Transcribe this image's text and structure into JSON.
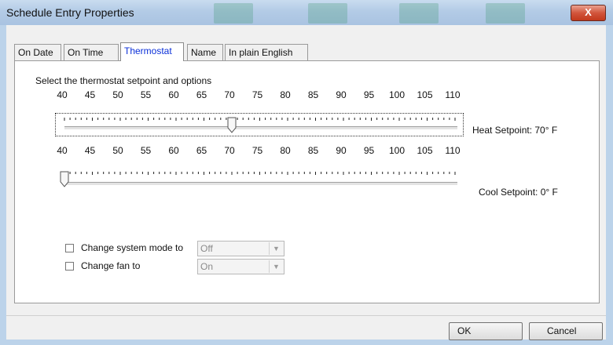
{
  "window": {
    "title": "Schedule Entry Properties",
    "close_glyph": "X"
  },
  "tabs": [
    {
      "label": "On Date"
    },
    {
      "label": "On Time"
    },
    {
      "label": "Thermostat",
      "active": true
    },
    {
      "label": "Name"
    },
    {
      "label": "In plain English"
    }
  ],
  "thermostat": {
    "instruction": "Select the thermostat setpoint and options",
    "scale_labels": [
      "40",
      "45",
      "50",
      "55",
      "60",
      "65",
      "70",
      "75",
      "80",
      "85",
      "90",
      "95",
      "100",
      "105",
      "110"
    ],
    "heat": {
      "label": "Heat Setpoint: 70° F",
      "value": 70,
      "min": 40,
      "max": 110
    },
    "cool": {
      "label": "Cool Setpoint: 0° F",
      "value": 0,
      "min": 40,
      "max": 110
    },
    "system_mode": {
      "label": "Change system mode to",
      "checked": false,
      "value": "Off"
    },
    "fan": {
      "label": "Change fan to",
      "checked": false,
      "value": "On"
    }
  },
  "buttons": {
    "ok": "OK",
    "cancel": "Cancel"
  },
  "colors": {
    "active_tab_text": "#0a2fd8",
    "titlebar": "#b3cbe6",
    "close_button": "#c2381c"
  }
}
